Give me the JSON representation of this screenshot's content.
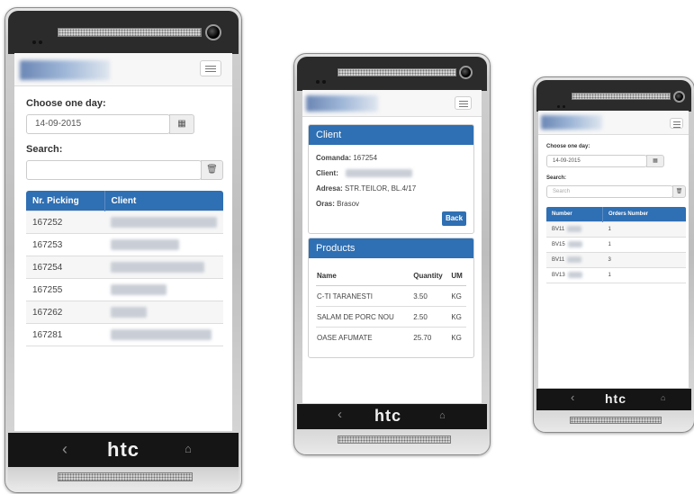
{
  "brand_label": "htc",
  "phone1": {
    "choose_day_label": "Choose one day:",
    "date_value": "14-09-2015",
    "search_label": "Search:",
    "search_value": "",
    "table": {
      "headers": [
        "Nr. Picking",
        "Client"
      ],
      "rows": [
        {
          "nr": "167252"
        },
        {
          "nr": "167253"
        },
        {
          "nr": "167254"
        },
        {
          "nr": "167255"
        },
        {
          "nr": "167262"
        },
        {
          "nr": "167281"
        }
      ]
    }
  },
  "phone2": {
    "client_panel": {
      "title": "Client",
      "comanda_label": "Comanda:",
      "comanda_value": "167254",
      "client_label": "Client:",
      "adresa_label": "Adresa:",
      "adresa_value": "STR.TEILOR, BL.4/17",
      "oras_label": "Oras:",
      "oras_value": "Brasov",
      "back_button": "Back"
    },
    "products_panel": {
      "title": "Products",
      "headers": [
        "Name",
        "Quantity",
        "UM"
      ],
      "rows": [
        {
          "name": "C-TI TARANESTI",
          "qty": "3.50",
          "um": "KG"
        },
        {
          "name": "SALAM DE PORC NOU",
          "qty": "2.50",
          "um": "KG"
        },
        {
          "name": "OASE AFUMATE",
          "qty": "25.70",
          "um": "KG"
        }
      ]
    }
  },
  "phone3": {
    "choose_day_label": "Choose one day:",
    "date_value": "14-09-2015",
    "search_label": "Search:",
    "search_placeholder": "Search",
    "table": {
      "headers": [
        "Number",
        "Orders Number"
      ],
      "rows": [
        {
          "number": "BV11",
          "orders": "1"
        },
        {
          "number": "BV15",
          "orders": "1"
        },
        {
          "number": "BV11",
          "orders": "3"
        },
        {
          "number": "BV13",
          "orders": "1"
        }
      ]
    }
  },
  "colors": {
    "header_blue": "#2f6fb3",
    "device_dark": "#151515",
    "device_silver": "#c8c8c8"
  },
  "icons": [
    "sensor-dots-icon",
    "speaker-grille-icon",
    "camera-icon",
    "hamburger-menu-icon",
    "calendar-icon",
    "trash-icon",
    "back-arrow-icon",
    "home-icon"
  ]
}
